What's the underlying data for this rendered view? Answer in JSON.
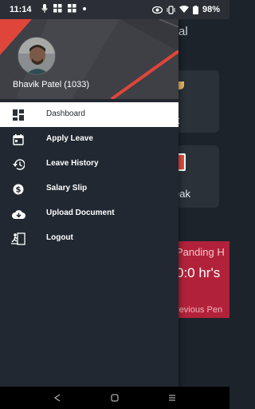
{
  "status_bar": {
    "time": "11:14",
    "battery": "98%",
    "left_icons": [
      "microphone-icon",
      "grid-icon",
      "grid-icon",
      "dot-icon"
    ],
    "right_icons": [
      "eye-icon",
      "vibrate-icon",
      "wifi-icon",
      "battery-icon"
    ]
  },
  "background": {
    "title_fragment": "al",
    "card_1_label": "k",
    "card_2_label": "Break",
    "pending_title": "Panding H",
    "pending_value": "0:0 hr's",
    "pending_sub": "revious Pen"
  },
  "drawer": {
    "user_name": "Bhavik Patel (1033)",
    "menu": [
      {
        "label": "Dashboard",
        "icon": "dashboard-icon",
        "active": true
      },
      {
        "label": "Apply Leave",
        "icon": "calendar-icon",
        "active": false
      },
      {
        "label": "Leave History",
        "icon": "history-icon",
        "active": false
      },
      {
        "label": "Salary Slip",
        "icon": "dollar-icon",
        "active": false
      },
      {
        "label": "Upload Document",
        "icon": "cloud-download-icon",
        "active": false
      },
      {
        "label": "Logout",
        "icon": "logout-icon",
        "active": false
      }
    ]
  },
  "colors": {
    "header_accent": "#e0453a",
    "pending_bg": "#b1223a",
    "drawer_bg": "#212831"
  }
}
